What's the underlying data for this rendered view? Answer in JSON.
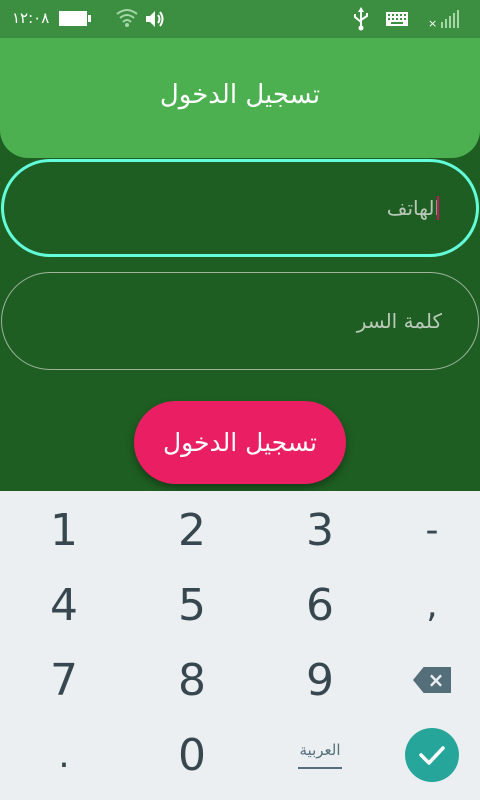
{
  "status_bar": {
    "time": "١٢:٠٨",
    "icons": [
      "battery-icon",
      "wifi-icon",
      "volume-icon",
      "usb-icon",
      "keyboard-icon",
      "signal-icon"
    ]
  },
  "header": {
    "title": "تسجيل الدخول"
  },
  "form": {
    "phone": {
      "placeholder": "الهاتف",
      "value": ""
    },
    "password": {
      "placeholder": "كلمة السر",
      "value": ""
    },
    "login_label": "تسجيل الدخول"
  },
  "keyboard": {
    "row1": [
      "1",
      "2",
      "3",
      "-"
    ],
    "row2": [
      "4",
      "5",
      "6",
      ","
    ],
    "row3": [
      "7",
      "8",
      "9"
    ],
    "row4": [
      ".",
      "0"
    ],
    "language_label": "العربية"
  },
  "colors": {
    "background": "#1e5e22",
    "header": "#4caf50",
    "status_bar": "#3c8f40",
    "field_focus_border": "#64ffda",
    "accent": "#e91e63",
    "keyboard_bg": "#eceff1",
    "enter_key": "#26a69a"
  }
}
